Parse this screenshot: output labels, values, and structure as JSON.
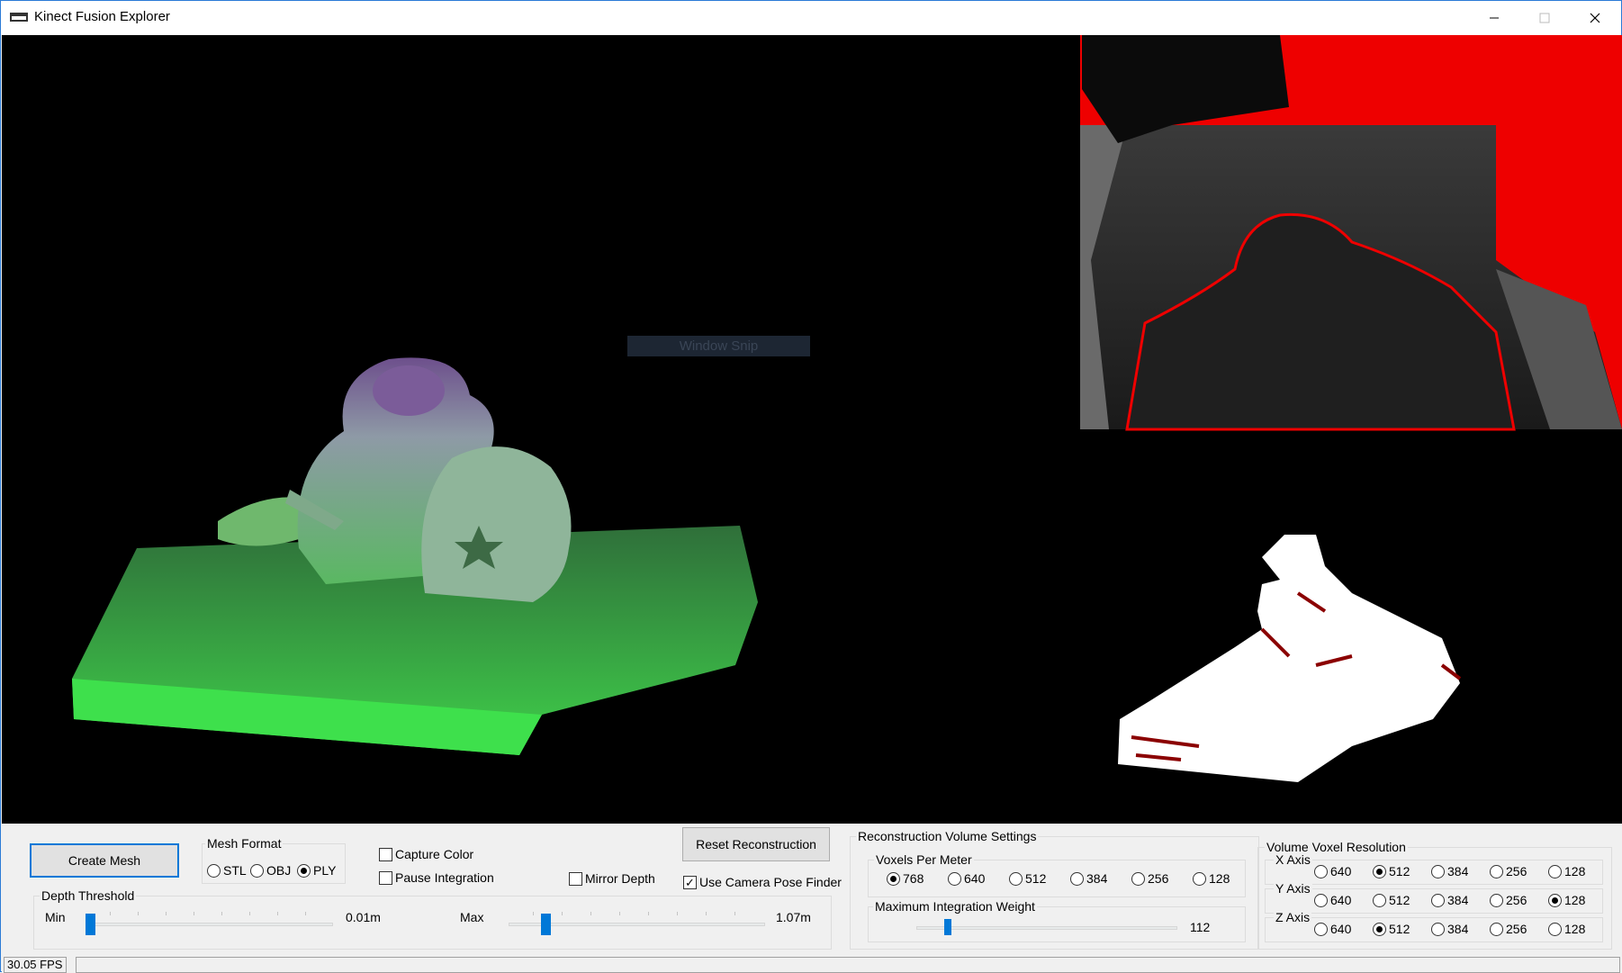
{
  "window": {
    "title": "Kinect Fusion Explorer"
  },
  "viewport": {
    "overlay_text": "Window Snip"
  },
  "controls": {
    "create_mesh": "Create Mesh",
    "mesh_format": {
      "label": "Mesh Format",
      "options": [
        "STL",
        "OBJ",
        "PLY"
      ],
      "selected": "PLY"
    },
    "capture_color": "Capture Color",
    "pause_integration": "Pause Integration",
    "mirror_depth": "Mirror Depth",
    "reset_reconstruction": "Reset Reconstruction",
    "use_camera_pose_finder": "Use Camera Pose Finder",
    "depth_threshold": {
      "label": "Depth Threshold",
      "min_label": "Min",
      "min_value": "0.01m",
      "max_label": "Max",
      "max_value": "1.07m"
    },
    "recon_volume": {
      "label": "Reconstruction Volume Settings",
      "voxels_per_meter": {
        "label": "Voxels Per Meter",
        "options": [
          "768",
          "640",
          "512",
          "384",
          "256",
          "128"
        ],
        "selected": "768"
      },
      "max_integration_weight": {
        "label": "Maximum Integration Weight",
        "value": "112"
      }
    },
    "voxel_resolution": {
      "label": "Volume Voxel Resolution",
      "x_axis": {
        "label": "X Axis",
        "options": [
          "640",
          "512",
          "384",
          "256",
          "128"
        ],
        "selected": "512"
      },
      "y_axis": {
        "label": "Y Axis",
        "options": [
          "640",
          "512",
          "384",
          "256",
          "128"
        ],
        "selected": "128"
      },
      "z_axis": {
        "label": "Z Axis",
        "options": [
          "640",
          "512",
          "384",
          "256",
          "128"
        ],
        "selected": "512"
      }
    }
  },
  "status": {
    "fps": "30.05 FPS"
  }
}
